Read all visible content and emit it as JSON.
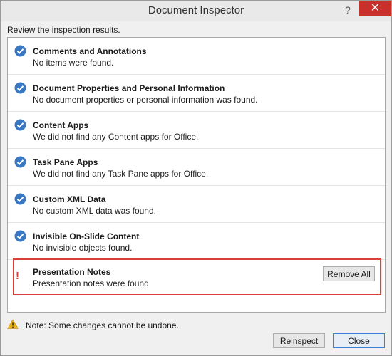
{
  "window": {
    "title": "Document Inspector",
    "help_label": "?",
    "close_label": "✕"
  },
  "instruction": "Review the inspection results.",
  "results": [
    {
      "name": "Comments and Annotations",
      "description": "No items were found.",
      "status": "ok",
      "icon": "check-icon"
    },
    {
      "name": "Document Properties and Personal Information",
      "description": "No document properties or personal information was found.",
      "status": "ok",
      "icon": "check-icon"
    },
    {
      "name": "Content Apps",
      "description": "We did not find any Content apps for Office.",
      "status": "ok",
      "icon": "check-icon"
    },
    {
      "name": "Task Pane Apps",
      "description": "We did not find any Task Pane apps for Office.",
      "status": "ok",
      "icon": "check-icon"
    },
    {
      "name": "Custom XML Data",
      "description": "No custom XML data was found.",
      "status": "ok",
      "icon": "check-icon"
    },
    {
      "name": "Invisible On-Slide Content",
      "description": "No invisible objects found.",
      "status": "ok",
      "icon": "check-icon"
    },
    {
      "name": "Presentation Notes",
      "description": "Presentation notes were found",
      "status": "found",
      "icon": "exclamation-icon",
      "action_label": "Remove All"
    }
  ],
  "note": "Note: Some changes cannot be undone.",
  "buttons": {
    "reinspect_first": "R",
    "reinspect_rest": "einspect",
    "close_first": "C",
    "close_rest": "lose"
  },
  "colors": {
    "check_blue": "#3b78c4",
    "alert_red": "#d9403a",
    "warning_yellow": "#e8b321"
  }
}
